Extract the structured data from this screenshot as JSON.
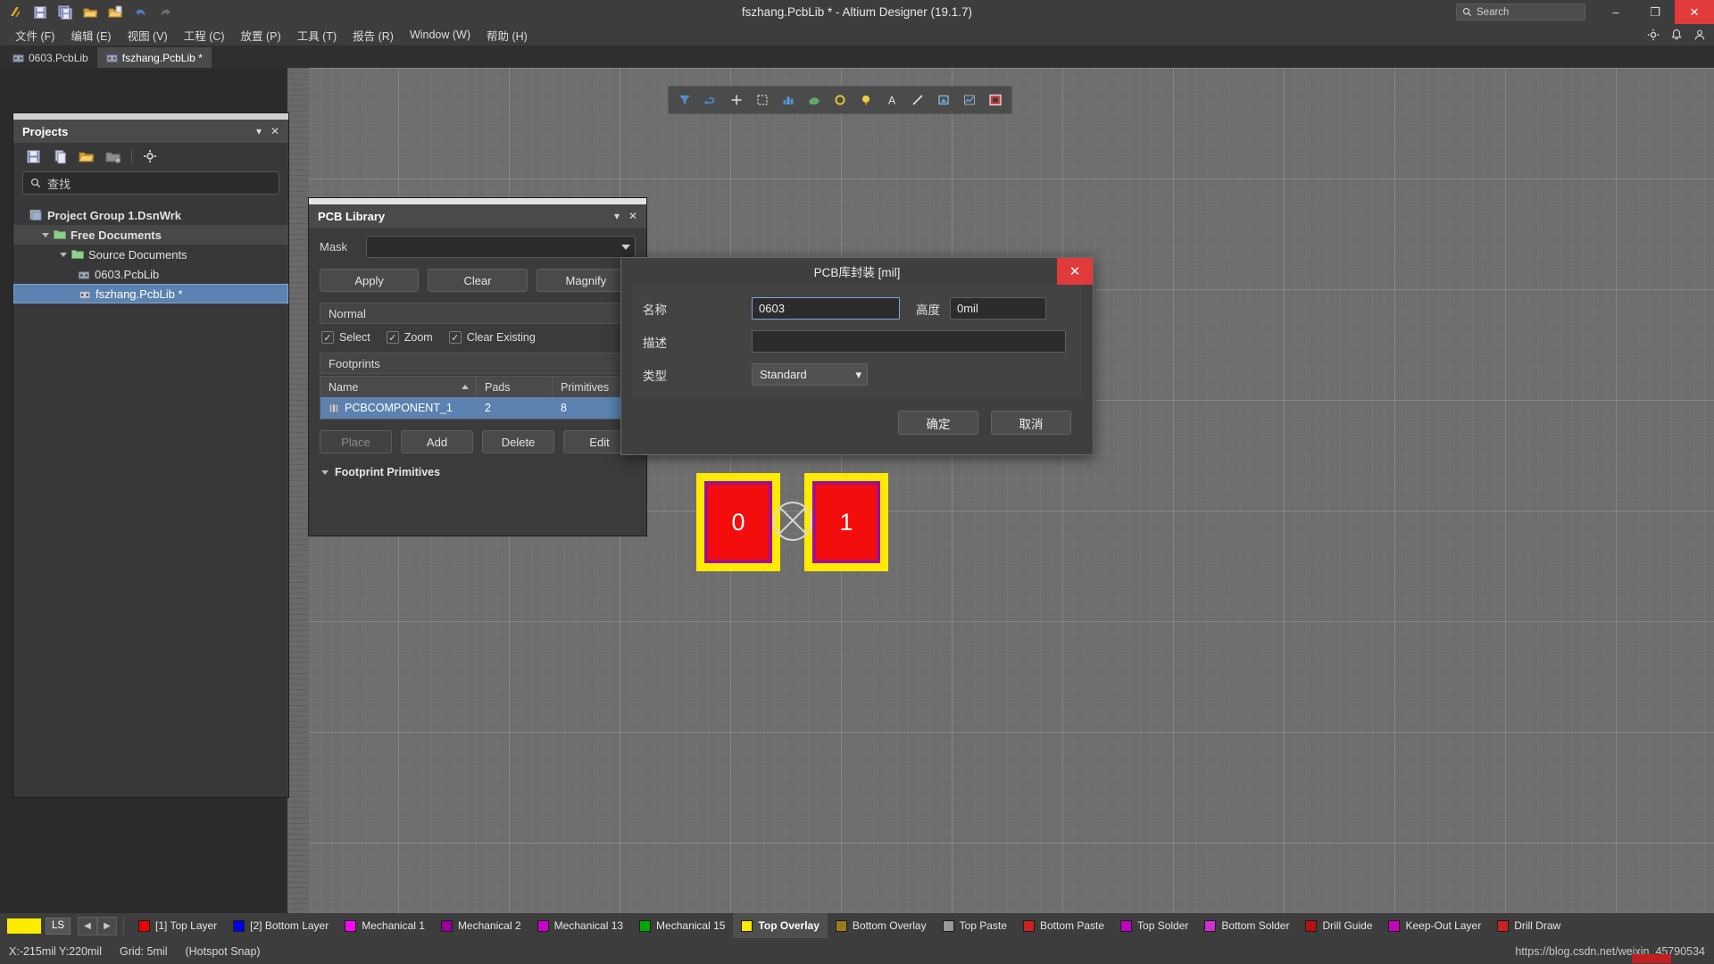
{
  "titlebar": {
    "title": "fszhang.PcbLib * - Altium Designer (19.1.7)",
    "search_placeholder": "Search",
    "icons": [
      "altium-logo-icon",
      "save-icon",
      "save-all-icon",
      "open-folder-icon",
      "open-project-icon",
      "undo-icon",
      "redo-icon"
    ],
    "minimize_label": "–",
    "maximize_label": "❐",
    "close_label": "✕"
  },
  "menubar": {
    "items": [
      {
        "label": "文件 (F)"
      },
      {
        "label": "编辑 (E)"
      },
      {
        "label": "视图 (V)"
      },
      {
        "label": "工程 (C)"
      },
      {
        "label": "放置 (P)"
      },
      {
        "label": "工具 (T)"
      },
      {
        "label": "报告 (R)"
      },
      {
        "label": "Window (W)"
      },
      {
        "label": "帮助 (H)"
      }
    ],
    "right_icons": [
      "gear-icon",
      "bell-icon",
      "user-icon"
    ]
  },
  "tabs": [
    {
      "label": "0603.PcbLib",
      "active": false
    },
    {
      "label": "fszhang.PcbLib *",
      "active": true
    }
  ],
  "projects_panel": {
    "title": "Projects",
    "collapse_label": "▾",
    "close_label": "✕",
    "toolbar_icons": [
      "save-icon",
      "copy-icon",
      "open-folder-icon",
      "add-folder-icon",
      "settings-gear-icon"
    ],
    "search_placeholder": "查找",
    "tree": [
      {
        "label": "Project Group 1.DsnWrk",
        "level": 1,
        "icon": "workspace-icon",
        "expanded": false,
        "selected": false
      },
      {
        "label": "Free Documents",
        "level": 2,
        "icon": "folder-icon",
        "expanded": true,
        "selected": false
      },
      {
        "label": "Source Documents",
        "level": 3,
        "icon": "folder-icon",
        "expanded": true,
        "selected": false
      },
      {
        "label": "0603.PcbLib",
        "level": 4,
        "icon": "pcblib-icon",
        "expanded": false,
        "selected": false
      },
      {
        "label": "fszhang.PcbLib *",
        "level": 4,
        "icon": "pcblib-icon",
        "expanded": false,
        "selected": true
      }
    ]
  },
  "pcb_library_panel": {
    "title": "PCB Library",
    "collapse_label": "▾",
    "close_label": "✕",
    "mask_label": "Mask",
    "mask_value": "",
    "buttons": [
      {
        "label": "Apply"
      },
      {
        "label": "Clear"
      },
      {
        "label": "Magnify"
      }
    ],
    "normal_label": "Normal",
    "checkboxes": [
      {
        "label": "Select",
        "checked": true
      },
      {
        "label": "Zoom",
        "checked": true
      },
      {
        "label": "Clear Existing",
        "checked": true
      }
    ],
    "footprints_header": "Footprints",
    "table": {
      "columns": [
        "Name",
        "Pads",
        "Primitives"
      ],
      "sort_column": "Name",
      "rows": [
        {
          "name": "PCBCOMPONENT_1",
          "pads": "2",
          "primitives": "8",
          "selected": true
        }
      ]
    },
    "action_buttons": [
      {
        "label": "Place",
        "disabled": true
      },
      {
        "label": "Add",
        "disabled": false
      },
      {
        "label": "Delete",
        "disabled": false
      },
      {
        "label": "Edit",
        "disabled": false
      }
    ],
    "footprint_primitives_label": "Footprint Primitives"
  },
  "dialog": {
    "title": "PCB库封装 [mil]",
    "close_label": "✕",
    "fields": {
      "name_label": "名称",
      "name_value": "0603",
      "height_label": "高度",
      "height_value": "0mil",
      "desc_label": "描述",
      "desc_value": "",
      "type_label": "类型",
      "type_value": "Standard",
      "type_caret": "▾"
    },
    "ok_label": "确定",
    "cancel_label": "取消"
  },
  "canvas": {
    "toolbar_icons": [
      "filter-icon",
      "net-icon",
      "place-via-icon",
      "place-pad-icon",
      "place-polygon-icon",
      "place-fill-icon",
      "place-arc-icon",
      "place-round-icon",
      "place-string-icon",
      "place-line-icon",
      "place-region-icon",
      "place-dimension-icon",
      "place-component-icon"
    ],
    "footprint": {
      "pad0_label": "0",
      "pad1_label": "1",
      "pad_fill_color": "#f40d0d",
      "pad_mask_color": "#a01090",
      "overlay_color": "#ffeb00",
      "origin_marker": "origin-crosshair"
    }
  },
  "layerbar": {
    "active_swatch_color": "#ffeb00",
    "ls_label": "LS",
    "prev_label": "◀",
    "next_label": "▶",
    "layers": [
      {
        "label": "[1] Top Layer",
        "color": "#ee0000",
        "active": false
      },
      {
        "label": "[2] Bottom Layer",
        "color": "#0000e6",
        "active": false
      },
      {
        "label": "Mechanical 1",
        "color": "#ff00ff",
        "active": false
      },
      {
        "label": "Mechanical 2",
        "color": "#990099",
        "active": false
      },
      {
        "label": "Mechanical 13",
        "color": "#cc00cc",
        "active": false
      },
      {
        "label": "Mechanical 15",
        "color": "#00aa00",
        "active": false
      },
      {
        "label": "Top Overlay",
        "color": "#ffeb00",
        "active": true
      },
      {
        "label": "Bottom Overlay",
        "color": "#9a7a18",
        "active": false
      },
      {
        "label": "Top Paste",
        "color": "#999999",
        "active": false
      },
      {
        "label": "Bottom Paste",
        "color": "#cc2222",
        "active": false
      },
      {
        "label": "Top Solder",
        "color": "#c000c0",
        "active": false
      },
      {
        "label": "Bottom Solder",
        "color": "#d030d0",
        "active": false
      },
      {
        "label": "Drill Guide",
        "color": "#bb1111",
        "active": false
      },
      {
        "label": "Keep-Out Layer",
        "color": "#cc00bb",
        "active": false
      },
      {
        "label": "Drill Draw",
        "color": "#cc2222",
        "active": false
      }
    ]
  },
  "statusbar": {
    "coords": "X:-215mil Y:220mil",
    "grid": "Grid: 5mil",
    "snap": "(Hotspot Snap)",
    "watermark": "https://blog.csdn.net/weixin_45790534"
  }
}
